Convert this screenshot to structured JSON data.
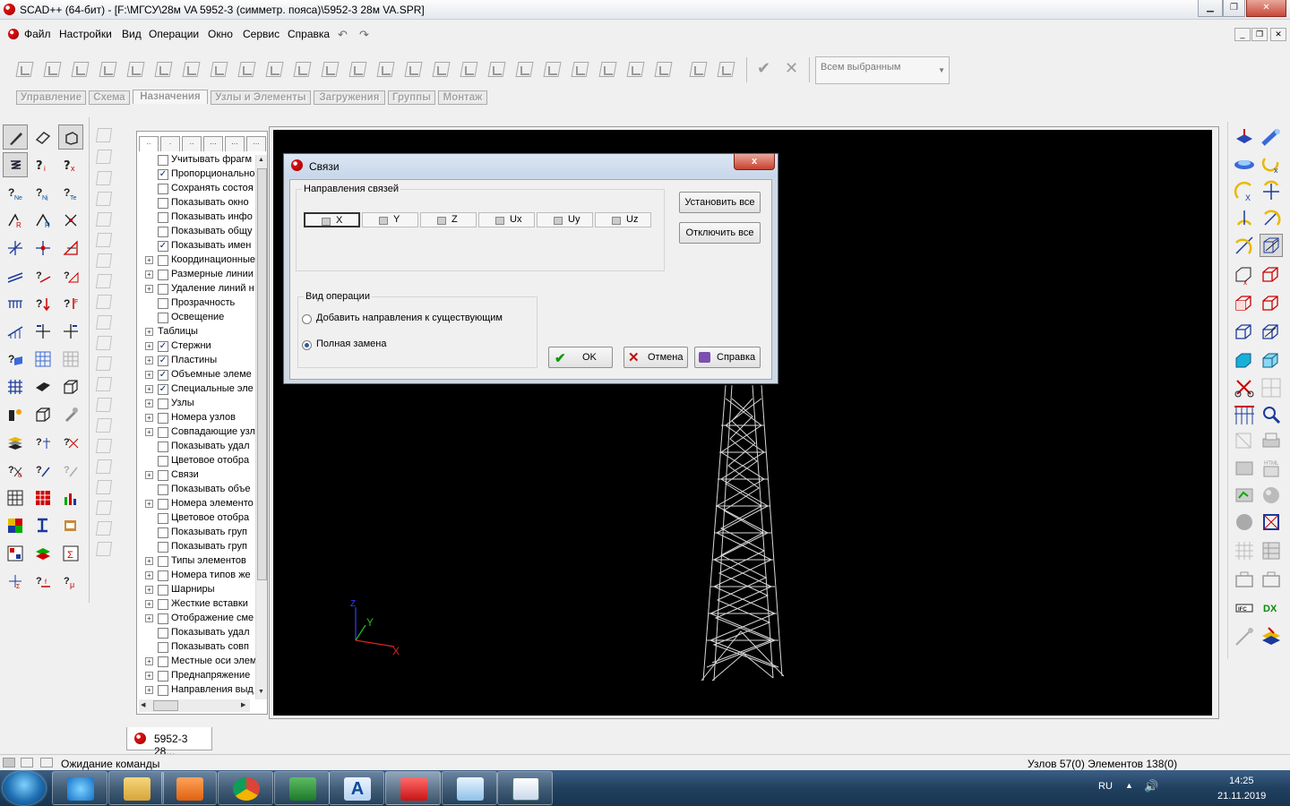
{
  "window": {
    "title": "SCAD++ (64-бит) - [F:\\МГСУ\\28м VA 5952-3 (симметр. пояса)\\5952-3 28м VA.SPR]",
    "controls": [
      "0",
      "1",
      "r"
    ]
  },
  "menu": {
    "items": [
      "Файл",
      "Настройки",
      "Вид",
      "Операции",
      "Окно",
      "Сервис",
      "Справка"
    ],
    "undo": "↶",
    "redo": "↷"
  },
  "toolbar": {
    "filter_combo": "Всем выбранным",
    "apply_icon": "✔",
    "cancel_icon": "✕"
  },
  "tabs": [
    "Управление",
    "Схема",
    "Назначения",
    "Узлы и Элементы",
    "Загружения",
    "Группы",
    "Монтаж"
  ],
  "active_tab": "Назначения",
  "tree": {
    "tab_labels": [
      "..",
      ".",
      "..",
      "...",
      "...",
      "..."
    ],
    "rows": [
      {
        "label": "Учитывать фрагм",
        "checked": false,
        "expandable": false
      },
      {
        "label": "Пропорционально",
        "checked": true,
        "expandable": false
      },
      {
        "label": "Сохранять состоя",
        "checked": false,
        "expandable": false
      },
      {
        "label": "Показывать окно",
        "checked": false,
        "expandable": false
      },
      {
        "label": "Показывать инфо",
        "checked": false,
        "expandable": false
      },
      {
        "label": "Показывать общу",
        "checked": false,
        "expandable": false
      },
      {
        "label": "Показывать имен",
        "checked": true,
        "expandable": false
      },
      {
        "label": "Координационные",
        "checked": false,
        "expandable": true
      },
      {
        "label": "Размерные линии",
        "checked": false,
        "expandable": true
      },
      {
        "label": "Удаление линий н",
        "checked": false,
        "expandable": true
      },
      {
        "label": "Прозрачность",
        "checked": false,
        "expandable": false
      },
      {
        "label": "Освещение",
        "checked": false,
        "expandable": false
      },
      {
        "label": "Таблицы",
        "checked": null,
        "expandable": true
      },
      {
        "label": "Стержни",
        "checked": true,
        "expandable": true
      },
      {
        "label": "Пластины",
        "checked": true,
        "expandable": true
      },
      {
        "label": "Объемные элеме",
        "checked": true,
        "expandable": true
      },
      {
        "label": "Специальные эле",
        "checked": true,
        "expandable": true
      },
      {
        "label": "Узлы",
        "checked": false,
        "expandable": true
      },
      {
        "label": "Номера узлов",
        "checked": false,
        "expandable": true
      },
      {
        "label": "Совпадающие узл",
        "checked": false,
        "expandable": true
      },
      {
        "label": "Показывать удал",
        "checked": false,
        "expandable": false
      },
      {
        "label": "Цветовое отобра",
        "checked": false,
        "expandable": false
      },
      {
        "label": "Связи",
        "checked": false,
        "expandable": true
      },
      {
        "label": "Показывать объе",
        "checked": false,
        "expandable": false
      },
      {
        "label": "Номера элементо",
        "checked": false,
        "expandable": true
      },
      {
        "label": "Цветовое отобра",
        "checked": false,
        "expandable": false
      },
      {
        "label": "Показывать груп",
        "checked": false,
        "expandable": false
      },
      {
        "label": "Показывать груп",
        "checked": false,
        "expandable": false
      },
      {
        "label": "Типы элементов",
        "checked": false,
        "expandable": true
      },
      {
        "label": "Номера типов же",
        "checked": false,
        "expandable": true
      },
      {
        "label": "Шарниры",
        "checked": false,
        "expandable": true
      },
      {
        "label": "Жесткие вставки",
        "checked": false,
        "expandable": true
      },
      {
        "label": "Отображение сме",
        "checked": false,
        "expandable": true
      },
      {
        "label": "Показывать удал",
        "checked": false,
        "expandable": false
      },
      {
        "label": "Показывать совп",
        "checked": false,
        "expandable": false
      },
      {
        "label": "Местные оси элем",
        "checked": false,
        "expandable": true
      },
      {
        "label": "Преднапряжение",
        "checked": false,
        "expandable": true
      },
      {
        "label": "Направления выд",
        "checked": false,
        "expandable": true
      }
    ]
  },
  "axes": {
    "x": "X",
    "y": "Y",
    "z": "Z"
  },
  "dialog": {
    "title": "Связи",
    "close": "x",
    "directions_group": "Направления связей",
    "directions": [
      "X",
      "Y",
      "Z",
      "Ux",
      "Uy",
      "Uz"
    ],
    "selected_direction": "X",
    "set_all": "Установить все",
    "clear_all": "Отключить все",
    "operation_group": "Вид операции",
    "op_add": "Добавить направления к существующим",
    "op_replace": "Полная замена",
    "selected_operation": "Полная замена",
    "ok": "OK",
    "cancel": "Отмена",
    "help": "Справка"
  },
  "document_tab": "5952-3 28...",
  "status": {
    "message": "Ожидание команды",
    "counts": "Узлов 57(0) Элементов 138(0)"
  },
  "taskbar": {
    "language": "RU",
    "time": "14:25",
    "date": "21.11.2019",
    "apps": [
      "Internet Explorer",
      "Проводник",
      "Media Player",
      "Chrome",
      "Excel",
      "AutoCAD",
      "SCAD++",
      "Paint",
      "Документ"
    ]
  },
  "colors": {
    "canvas": "#000000",
    "wireframe": "#d8d8d8",
    "axis_x": "#e02020",
    "axis_y": "#20c020",
    "axis_z": "#3040ff",
    "taskbar": "#21405f"
  }
}
